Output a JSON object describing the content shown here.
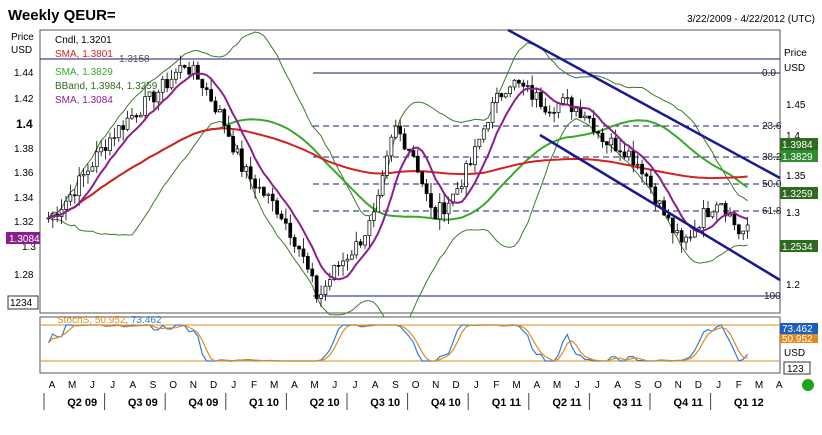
{
  "window": {
    "title": "Weekly QEUR=",
    "date_range": "3/22/2009 - 4/22/2012 (UTC)"
  },
  "main_panel": {
    "left_axis_label_1": "Price",
    "left_axis_label_2": "USD",
    "right_axis_label_1": "Price",
    "right_axis_label_2": "USD",
    "scale_box": "1234",
    "legend": [
      {
        "text": "Cndl, 1.3201",
        "color": "#000000"
      },
      {
        "text": "SMA, 1.3801",
        "color": "#d42020"
      },
      {
        "text": "SMA, 1.3829",
        "color": "#3aa82a"
      },
      {
        "text": "BBand, 1.3984, 1.3259",
        "color": "#2f6b1f"
      },
      {
        "text": "SMA, 1.3084",
        "color": "#8a1f8f"
      }
    ],
    "legend_overlap_text": "1.3158",
    "left_ticks": [
      "1.44",
      "1.42",
      "1.4",
      "1.38",
      "1.36",
      "1.34",
      "1.32",
      "1.3",
      "1.28"
    ],
    "left_flag": "1.3084",
    "right_ticks": [
      "1.45",
      "1.4",
      "1.35",
      "1.3",
      "1.25",
      "1.2"
    ],
    "fib_labels": [
      "0.0",
      "23.6",
      "38.2",
      "50.0",
      "61.8",
      "100"
    ],
    "right_flags": [
      {
        "text": "1.3984",
        "bg": "#2e6b1f",
        "fg": "#ffffff"
      },
      {
        "text": "1.3829",
        "bg": "#2e8b2e",
        "fg": "#ffffff"
      },
      {
        "text": "1.3259",
        "bg": "#2e6b1f",
        "fg": "#ffffff"
      },
      {
        "text": "1.2534",
        "bg": "#2e6b1f",
        "fg": "#ffffff"
      }
    ]
  },
  "stoch_panel": {
    "label_prefix": "StochS, ",
    "value_1": "50.952",
    "value_2": "73.462",
    "flag_1": "73.462",
    "flag_2": "50.952",
    "unit": "USD",
    "scale_box": "123"
  },
  "x_axis": {
    "months": [
      "A",
      "M",
      "J",
      "J",
      "A",
      "S",
      "O",
      "N",
      "D",
      "J",
      "F",
      "M",
      "A",
      "M",
      "J",
      "J",
      "A",
      "S",
      "O",
      "N",
      "D",
      "J",
      "F",
      "M",
      "A",
      "M",
      "J",
      "J",
      "A",
      "S",
      "O",
      "N",
      "D",
      "J",
      "F",
      "M",
      "A"
    ],
    "quarters": [
      "Q2 09",
      "Q3 09",
      "Q4 09",
      "Q1 10",
      "Q2 10",
      "Q3 10",
      "Q4 10",
      "Q1 11",
      "Q2 11",
      "Q3 11",
      "Q4 11",
      "Q1 12"
    ]
  },
  "status_indicator": {
    "color": "#1aa51a"
  },
  "chart_data": {
    "type": "candlestick",
    "title": "Weekly QEUR=",
    "ylabel": "Price USD",
    "ylim": [
      1.262,
      1.464
    ],
    "x_range": [
      "2009-03-22",
      "2012-04-22"
    ],
    "close_series": [
      {
        "date": "2009-04-01",
        "close": 1.33
      },
      {
        "date": "2009-05-01",
        "close": 1.345
      },
      {
        "date": "2009-06-01",
        "close": 1.365
      },
      {
        "date": "2009-07-01",
        "close": 1.385
      },
      {
        "date": "2009-08-01",
        "close": 1.4
      },
      {
        "date": "2009-09-01",
        "close": 1.412
      },
      {
        "date": "2009-10-01",
        "close": 1.425
      },
      {
        "date": "2009-11-01",
        "close": 1.44
      },
      {
        "date": "2009-12-01",
        "close": 1.425
      },
      {
        "date": "2010-01-01",
        "close": 1.4
      },
      {
        "date": "2010-02-01",
        "close": 1.365
      },
      {
        "date": "2010-03-01",
        "close": 1.35
      },
      {
        "date": "2010-04-01",
        "close": 1.335
      },
      {
        "date": "2010-05-01",
        "close": 1.31
      },
      {
        "date": "2010-06-01",
        "close": 1.272
      },
      {
        "date": "2010-07-01",
        "close": 1.295
      },
      {
        "date": "2010-08-01",
        "close": 1.31
      },
      {
        "date": "2010-09-01",
        "close": 1.332
      },
      {
        "date": "2010-10-01",
        "close": 1.395
      },
      {
        "date": "2010-11-01",
        "close": 1.375
      },
      {
        "date": "2010-12-01",
        "close": 1.33
      },
      {
        "date": "2011-01-01",
        "close": 1.345
      },
      {
        "date": "2011-02-01",
        "close": 1.37
      },
      {
        "date": "2011-03-01",
        "close": 1.405
      },
      {
        "date": "2011-04-01",
        "close": 1.428
      },
      {
        "date": "2011-05-01",
        "close": 1.42
      },
      {
        "date": "2011-06-01",
        "close": 1.41
      },
      {
        "date": "2011-07-01",
        "close": 1.412
      },
      {
        "date": "2011-08-01",
        "close": 1.405
      },
      {
        "date": "2011-09-01",
        "close": 1.385
      },
      {
        "date": "2011-10-01",
        "close": 1.38
      },
      {
        "date": "2011-11-01",
        "close": 1.365
      },
      {
        "date": "2011-12-01",
        "close": 1.335
      },
      {
        "date": "2012-01-01",
        "close": 1.31
      },
      {
        "date": "2012-02-01",
        "close": 1.33
      },
      {
        "date": "2012-03-01",
        "close": 1.345
      },
      {
        "date": "2012-04-01",
        "close": 1.32
      }
    ]
  }
}
